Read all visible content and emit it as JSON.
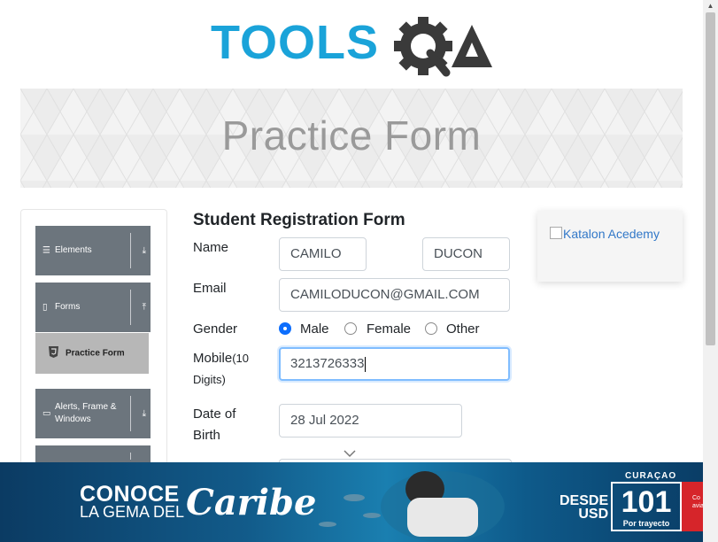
{
  "header": {
    "logo_alt": "TOOLSQA",
    "logo_tools": "TOOLS",
    "logo_q": "Q",
    "logo_a": "A"
  },
  "banner": {
    "title": "Practice Form"
  },
  "sidebar": {
    "groups": [
      {
        "label": "Elements",
        "icon": "hamburger-icon",
        "arrow": "download-icon"
      },
      {
        "label": "Forms",
        "icon": "document-icon",
        "arrow": "upload-icon"
      },
      {
        "label": "Alerts, Frame & Windows",
        "icon": "window-icon",
        "arrow": "download-icon"
      }
    ],
    "active_item": {
      "label": "Practice Form",
      "icon": "html5-icon"
    }
  },
  "form": {
    "heading": "Student Registration Form",
    "name_label": "Name",
    "first_name": "CAMILO",
    "last_name": "DUCON",
    "email_label": "Email",
    "email": "CAMILODUCON@GMAIL.COM",
    "gender_label": "Gender",
    "gender_options": [
      "Male",
      "Female",
      "Other"
    ],
    "gender_selected": "Male",
    "mobile_label": "Mobile",
    "mobile_hint": "(10",
    "mobile_hint2": "Digits)",
    "mobile": "3213726333",
    "dob_label_1": "Date of",
    "dob_label_2": "Birth",
    "dob": "28 Jul 2022"
  },
  "side_ad": {
    "alt": "Katalon Acedemy"
  },
  "bottom_ad": {
    "line1": "CONOCE",
    "line2": "LA GEMA DEL",
    "script": "Caribe",
    "desde": "DESDE",
    "usd": "USD",
    "price": "101",
    "per": "Por trayecto",
    "destination": "CURAÇAO",
    "cta": "Co avia"
  },
  "colors": {
    "brand_blue": "#1aa3d9",
    "sidebar_gray": "#6c757d",
    "active_gray": "#b7b7b7",
    "radio_blue": "#0d6efd",
    "focus_border": "#80bdff"
  }
}
